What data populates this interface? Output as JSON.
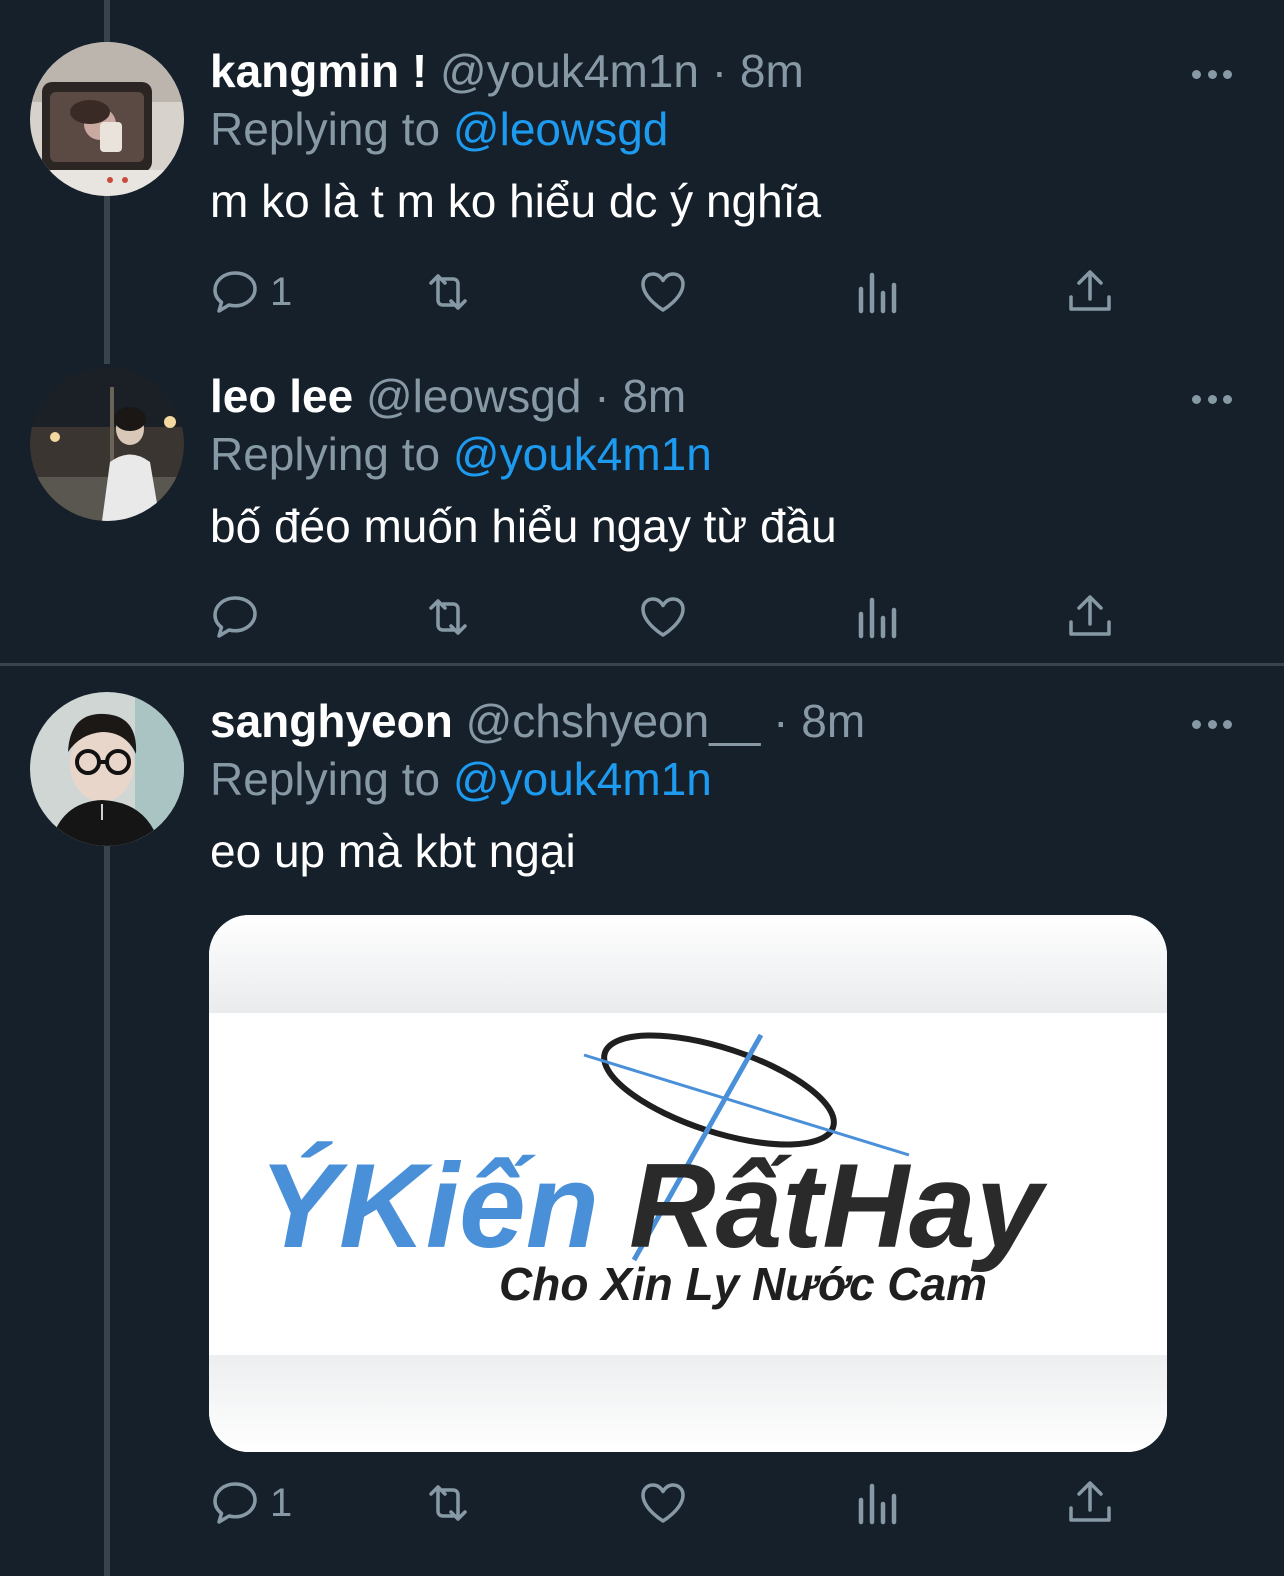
{
  "colors": {
    "background": "#15202b",
    "secondary_text": "#8899a6",
    "accent": "#1d9bf0",
    "thread_line": "#38444d"
  },
  "tweets": [
    {
      "display_name": "kangmin !",
      "handle": "@youk4m1n",
      "separator": "·",
      "time": "8m",
      "replying_to_label": "Replying to",
      "replying_to": "@leowsgd",
      "text": "m ko là t m ko hiểu dc ý nghĩa",
      "reply_count": "1"
    },
    {
      "display_name": "leo lee",
      "handle": "@leowsgd",
      "separator": "·",
      "time": "8m",
      "replying_to_label": "Replying to",
      "replying_to": "@youk4m1n",
      "text": "bố đéo muốn hiểu ngay từ đầu",
      "reply_count": ""
    },
    {
      "display_name": "sanghyeon",
      "handle": "@chshyeon__",
      "separator": "·",
      "time": "8m",
      "replying_to_label": "Replying to",
      "replying_to": "@youk4m1n",
      "text": "eo up mà kbt ngại",
      "reply_count": "1",
      "media": {
        "logo_part1": "ÝKiến",
        "logo_part2": "RấtHay",
        "logo_tagline": "Cho Xin Ly Nước Cam"
      }
    }
  ]
}
